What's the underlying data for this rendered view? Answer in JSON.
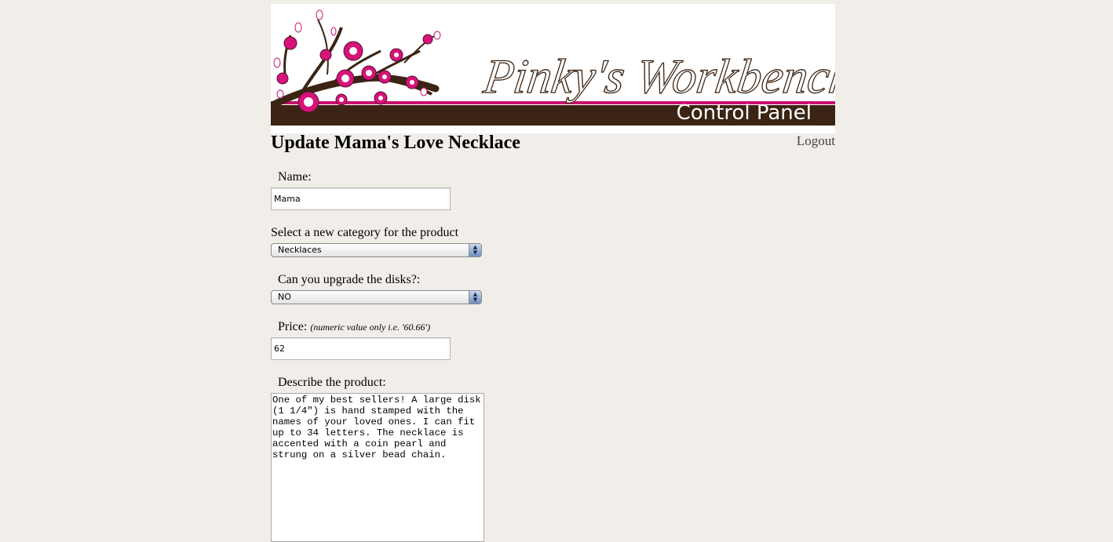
{
  "header": {
    "brand_title": "Pinky's Workbench",
    "brand_subtitle": "Control Panel",
    "colors": {
      "brown": "#3b2413",
      "pink": "#c8106e",
      "background": "#f1eee9"
    }
  },
  "page": {
    "title": "Update Mama's Love Necklace",
    "logout_label": "Logout"
  },
  "form": {
    "name_label": "Name:",
    "name_value": "Mama",
    "category_label": "Select a new category for the product",
    "category_selected": "Necklaces",
    "upgrade_label": "Can you upgrade the disks?:",
    "upgrade_selected": "NO",
    "price_label": "Price:",
    "price_hint": "(numeric value only i.e. '60.66')",
    "price_value": "62",
    "description_label": "Describe the product:",
    "description_value": "One of my best sellers! A large disk (1 1/4\") is hand stamped with the names of your loved ones. I can fit up to 34 letters. The necklace is accented with a coin pearl and strung on a silver bead chain."
  }
}
